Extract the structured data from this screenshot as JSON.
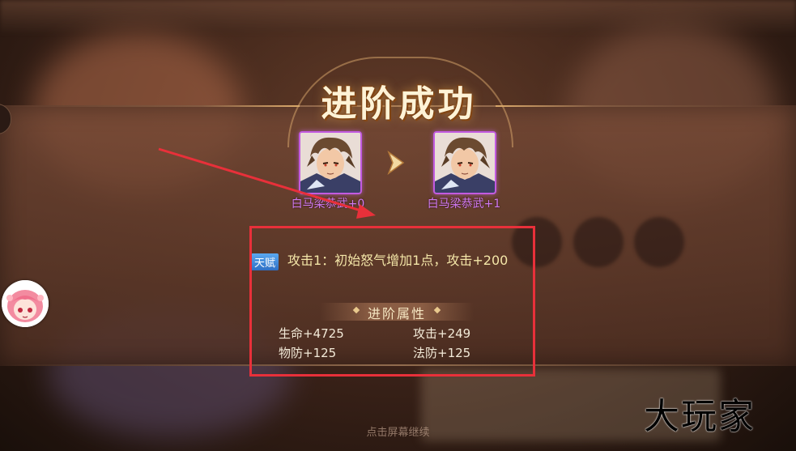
{
  "title": "进阶成功",
  "hero": {
    "from_name": "白马梁恭武+0",
    "to_name": "白马梁恭武+1",
    "rarity_color": "#c25be0"
  },
  "talent": {
    "badge": "天赋",
    "text": "攻击1：初始怒气增加1点，攻击+200"
  },
  "attributes": {
    "header": "进阶属性",
    "items": [
      {
        "label": "生命+4725"
      },
      {
        "label": "攻击+249"
      },
      {
        "label": "物防+125"
      },
      {
        "label": "法防+125"
      }
    ]
  },
  "footer_hint": "点击屏幕继续",
  "watermark": "大玩家",
  "colors": {
    "title": "#fff3d6",
    "talent_text": "#f4e6a8",
    "annotation": "#e8303a",
    "hero_name": "#d07af0"
  }
}
